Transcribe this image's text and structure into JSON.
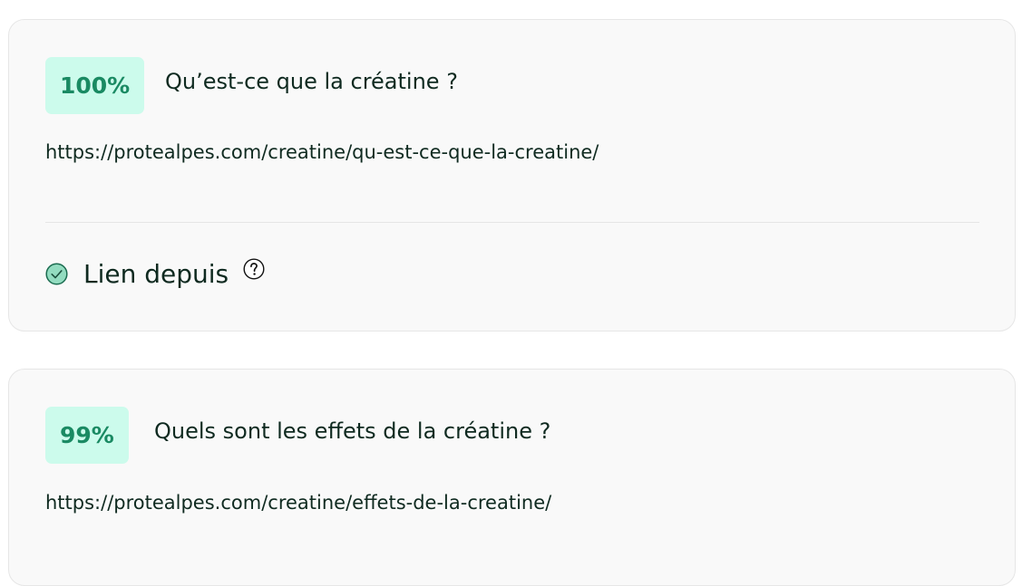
{
  "results": [
    {
      "score": "100%",
      "title": "Qu’est-ce que la créatine ?",
      "url": "https://protealpes.com/creatine/qu-est-ce-que-la-creatine/",
      "link_label": "Lien depuis",
      "link_icon": "check-circle-icon",
      "help_icon": "question-circle-icon"
    },
    {
      "score": "99%",
      "title": "Quels sont les effets de la créatine ?",
      "url": "https://protealpes.com/creatine/effets-de-la-creatine/"
    }
  ],
  "colors": {
    "badge_bg": "#ccfbec",
    "badge_text": "#1a8a63",
    "card_bg": "#f9f9f9",
    "card_border": "#e6e6e6",
    "text": "#0f2a20",
    "check_fill": "#93dcc0",
    "check_stroke": "#1a6b4f"
  }
}
